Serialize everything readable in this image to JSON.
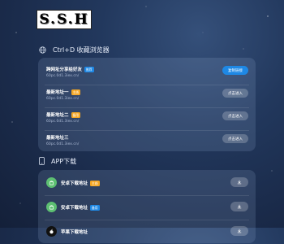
{
  "logo": {
    "text": "S.S.H"
  },
  "browser_section": {
    "icon": "globe-icon",
    "title": "Ctrl+D 收藏浏览器",
    "rows": [
      {
        "title": "跨网址分享给好友",
        "badge": "推荐",
        "badge_color": "#1e88e5",
        "url": "60pc.0d1.3iex.cn/",
        "button": "复制链接",
        "button_style": "primary"
      },
      {
        "title": "最新地址一",
        "badge": "主线",
        "badge_color": "#f5a623",
        "url": "60pc.0d1.3iex.cn/",
        "button": "点击进入",
        "button_style": "secondary"
      },
      {
        "title": "最新地址二",
        "badge": "备用",
        "badge_color": "#f5a623",
        "url": "60pc.0d1.3iex.cn/",
        "button": "点击进入",
        "button_style": "secondary"
      },
      {
        "title": "最新地址三",
        "badge": "",
        "badge_color": "",
        "url": "60pc.0d1.3iex.cn/",
        "button": "点击进入",
        "button_style": "secondary"
      }
    ]
  },
  "app_section": {
    "icon": "phone-icon",
    "title": "APP下载",
    "rows": [
      {
        "icon": "android-icon",
        "label": "安卓下载地址",
        "badge": "主线",
        "badge_color": "#f5a623",
        "button_icon": "download-icon"
      },
      {
        "icon": "android-icon",
        "label": "安卓下载地址",
        "badge": "备用",
        "badge_color": "#1e88e5",
        "button_icon": "download-icon"
      },
      {
        "icon": "apple-icon",
        "label": "苹果下载地址",
        "badge": "",
        "badge_color": "",
        "button_icon": "download-icon"
      }
    ]
  }
}
